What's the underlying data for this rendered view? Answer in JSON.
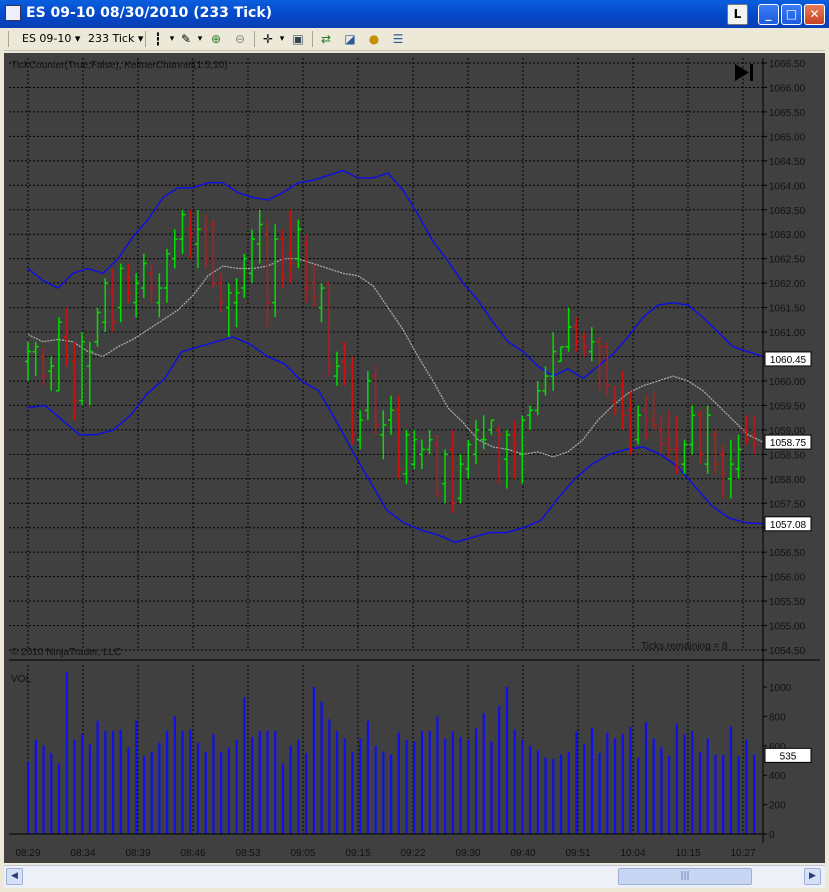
{
  "window": {
    "title": "ES 09-10  08/30/2010 (233 Tick)",
    "buttons": {
      "l": "L",
      "minimize": "_",
      "maximize": "□",
      "close": "✕"
    }
  },
  "toolbar": {
    "instrument": "ES 09-10",
    "period": "233 Tick",
    "icons": [
      "bar-type-icon",
      "draw-pencil-icon",
      "zoom-in-icon",
      "zoom-out-icon",
      "crosshair-icon",
      "properties-icon",
      "data-series-icon",
      "indicators-icon",
      "strategies-icon",
      "data-box-icon"
    ]
  },
  "chart": {
    "indicator_label": "TickCounter(True,False), KeltnerChannel(1.5,10)",
    "copyright": "© 2010 NinjaTrader, LLC",
    "ticks_remaining": "Ticks remaining = 8",
    "volume_label": "VOL",
    "colors": {
      "background": "#404040",
      "up_bar": "#00dd00",
      "down_bar": "#cc1111",
      "keltner_band": "#1010dd",
      "keltner_mid": "#b0b0b0",
      "volume": "#1010ee",
      "grid": "#000000",
      "label_box": "#ffffff"
    }
  },
  "chart_data": {
    "type": "bar",
    "subtype": "ohlc_price_with_volume",
    "price_axis": {
      "min": 1054.5,
      "max": 1066.5,
      "ticks": [
        "1066.50",
        "1066.00",
        "1065.50",
        "1065.00",
        "1064.50",
        "1064.00",
        "1063.50",
        "1063.00",
        "1062.50",
        "1062.00",
        "1061.50",
        "1061.00",
        "1060.50",
        "1060.00",
        "1059.50",
        "1059.00",
        "1058.50",
        "1058.00",
        "1057.50",
        "1057.00",
        "1056.50",
        "1056.00",
        "1055.50",
        "1055.00",
        "1054.50"
      ]
    },
    "volume_axis": {
      "min": 0,
      "max": 1000,
      "ticks": [
        "1000",
        "800",
        "600",
        "400",
        "200",
        "0"
      ]
    },
    "x_tick_labels": [
      "08:29",
      "08:34",
      "08:39",
      "08:46",
      "08:53",
      "09:05",
      "09:15",
      "09:22",
      "09:30",
      "09:40",
      "09:51",
      "10:04",
      "10:15",
      "10:27"
    ],
    "price_markers": {
      "keltner_upper": "1060.45",
      "last_price": "1058.75",
      "keltner_lower": "1057.08"
    },
    "volume_marker": "535",
    "ohlc": [
      [
        1060.4,
        1060.8,
        1060.0,
        1060.6
      ],
      [
        1060.6,
        1060.8,
        1060.1,
        1060.7
      ],
      [
        1060.5,
        1060.7,
        1059.9,
        1060.1
      ],
      [
        1060.2,
        1060.5,
        1059.8,
        1060.3
      ],
      [
        1059.8,
        1061.3,
        1059.8,
        1061.2
      ],
      [
        1060.9,
        1061.5,
        1060.3,
        1060.5
      ],
      [
        1060.4,
        1060.8,
        1059.2,
        1059.6
      ],
      [
        1059.6,
        1061.0,
        1059.5,
        1060.8
      ],
      [
        1060.3,
        1060.8,
        1059.5,
        1060.6
      ],
      [
        1060.8,
        1061.5,
        1060.7,
        1061.4
      ],
      [
        1061.2,
        1062.1,
        1061.0,
        1062.0
      ],
      [
        1061.8,
        1062.3,
        1061.0,
        1061.2
      ],
      [
        1061.5,
        1062.4,
        1061.2,
        1062.3
      ],
      [
        1062.1,
        1062.4,
        1061.6,
        1061.8
      ],
      [
        1061.6,
        1062.2,
        1061.3,
        1062.0
      ],
      [
        1061.9,
        1062.6,
        1061.7,
        1062.4
      ],
      [
        1062.2,
        1062.4,
        1061.6,
        1061.9
      ],
      [
        1061.6,
        1062.2,
        1061.3,
        1061.9
      ],
      [
        1061.9,
        1062.7,
        1061.6,
        1062.6
      ],
      [
        1062.5,
        1063.1,
        1062.3,
        1062.9
      ],
      [
        1062.9,
        1063.5,
        1062.6,
        1063.4
      ],
      [
        1063.1,
        1063.5,
        1062.5,
        1063.0
      ],
      [
        1062.8,
        1063.5,
        1062.3,
        1063.1
      ],
      [
        1063.1,
        1063.4,
        1062.3,
        1062.5
      ],
      [
        1063.2,
        1063.3,
        1061.9,
        1062.0
      ],
      [
        1062.0,
        1062.2,
        1061.4,
        1061.6
      ],
      [
        1061.5,
        1062.0,
        1060.9,
        1061.8
      ],
      [
        1061.6,
        1062.1,
        1061.1,
        1061.8
      ],
      [
        1061.9,
        1062.6,
        1061.7,
        1062.5
      ],
      [
        1062.2,
        1063.1,
        1062.0,
        1062.9
      ],
      [
        1062.8,
        1063.5,
        1062.4,
        1063.2
      ],
      [
        1063.0,
        1063.3,
        1061.1,
        1061.6
      ],
      [
        1061.6,
        1063.2,
        1061.3,
        1062.9
      ],
      [
        1062.9,
        1063.1,
        1061.9,
        1062.1
      ],
      [
        1062.6,
        1063.5,
        1062.0,
        1062.4
      ],
      [
        1062.5,
        1063.3,
        1062.3,
        1063.1
      ],
      [
        1062.8,
        1063.0,
        1061.6,
        1061.9
      ],
      [
        1062.0,
        1062.4,
        1061.5,
        1061.7
      ],
      [
        1061.5,
        1062.0,
        1061.2,
        1061.9
      ],
      [
        1062.0,
        1062.0,
        1060.1,
        1060.3
      ],
      [
        1060.1,
        1060.6,
        1059.9,
        1060.3
      ],
      [
        1060.4,
        1060.8,
        1059.9,
        1060.2
      ],
      [
        1060.3,
        1060.5,
        1058.7,
        1058.9
      ],
      [
        1058.8,
        1059.4,
        1058.6,
        1059.2
      ],
      [
        1059.4,
        1060.2,
        1059.2,
        1060.0
      ],
      [
        1060.1,
        1060.3,
        1058.9,
        1059.1
      ],
      [
        1058.9,
        1059.4,
        1058.4,
        1059.1
      ],
      [
        1059.2,
        1059.7,
        1058.9,
        1059.4
      ],
      [
        1059.4,
        1059.7,
        1058.0,
        1058.2
      ],
      [
        1058.1,
        1059.0,
        1057.9,
        1058.9
      ],
      [
        1058.3,
        1059.0,
        1058.2,
        1058.8
      ],
      [
        1058.5,
        1058.8,
        1058.2,
        1058.6
      ],
      [
        1058.6,
        1059.0,
        1058.5,
        1058.8
      ],
      [
        1058.7,
        1058.9,
        1057.6,
        1057.7
      ],
      [
        1057.9,
        1058.6,
        1057.5,
        1058.5
      ],
      [
        1058.6,
        1059.0,
        1057.3,
        1057.5
      ],
      [
        1057.6,
        1058.5,
        1057.5,
        1058.3
      ],
      [
        1058.2,
        1058.8,
        1058.0,
        1058.7
      ],
      [
        1058.5,
        1059.2,
        1058.3,
        1059.0
      ],
      [
        1058.8,
        1059.3,
        1058.6,
        1058.8
      ],
      [
        1059.0,
        1059.2,
        1058.9,
        1059.2
      ],
      [
        1059.0,
        1059.1,
        1057.9,
        1058.9
      ],
      [
        1058.4,
        1059.0,
        1057.8,
        1058.9
      ],
      [
        1058.9,
        1059.2,
        1058.0,
        1058.7
      ],
      [
        1058.5,
        1059.3,
        1057.9,
        1059.2
      ],
      [
        1059.3,
        1059.5,
        1059.0,
        1059.4
      ],
      [
        1059.4,
        1060.0,
        1059.3,
        1059.8
      ],
      [
        1059.8,
        1060.3,
        1059.7,
        1060.1
      ],
      [
        1060.1,
        1061.0,
        1059.8,
        1060.6
      ],
      [
        1060.4,
        1060.7,
        1060.4,
        1060.7
      ],
      [
        1060.7,
        1061.5,
        1060.6,
        1061.1
      ],
      [
        1061.1,
        1061.3,
        1060.6,
        1060.8
      ],
      [
        1060.9,
        1061.0,
        1060.5,
        1060.7
      ],
      [
        1060.6,
        1061.1,
        1060.4,
        1060.8
      ],
      [
        1060.8,
        1060.9,
        1059.8,
        1060.7
      ],
      [
        1060.7,
        1060.8,
        1059.7,
        1059.9
      ],
      [
        1059.6,
        1059.9,
        1059.3,
        1059.4
      ],
      [
        1059.9,
        1060.2,
        1059.0,
        1059.3
      ],
      [
        1059.4,
        1059.8,
        1058.5,
        1058.6
      ],
      [
        1058.8,
        1059.5,
        1058.7,
        1059.3
      ],
      [
        1059.4,
        1059.7,
        1058.8,
        1058.9
      ],
      [
        1059.2,
        1059.8,
        1059.0,
        1059.1
      ],
      [
        1059.0,
        1059.3,
        1058.5,
        1058.7
      ],
      [
        1058.8,
        1059.4,
        1058.4,
        1058.6
      ],
      [
        1058.6,
        1059.3,
        1058.1,
        1058.2
      ],
      [
        1058.3,
        1058.8,
        1058.1,
        1058.7
      ],
      [
        1058.7,
        1059.5,
        1058.5,
        1059.3
      ],
      [
        1059.3,
        1059.4,
        1058.3,
        1058.5
      ],
      [
        1058.3,
        1059.5,
        1058.1,
        1059.3
      ],
      [
        1058.9,
        1059.0,
        1058.1,
        1058.3
      ],
      [
        1058.5,
        1058.7,
        1057.6,
        1058.1
      ],
      [
        1058.0,
        1058.8,
        1057.6,
        1058.3
      ],
      [
        1058.2,
        1058.9,
        1058.0,
        1058.6
      ],
      [
        1059.0,
        1059.3,
        1058.7,
        1058.8
      ],
      [
        1058.9,
        1059.3,
        1058.5,
        1058.7
      ]
    ],
    "keltner_upper": [
      1062.3,
      1062.05,
      1061.9,
      1062.2,
      1062.3,
      1062.2,
      1062.5,
      1062.95,
      1063.3,
      1063.75,
      1063.95,
      1063.95,
      1064.05,
      1064.05,
      1063.85,
      1063.75,
      1063.7,
      1063.85,
      1064.05,
      1064.1,
      1064.2,
      1064.3,
      1064.15,
      1064.15,
      1064.25,
      1063.9,
      1063.4,
      1062.85,
      1062.45,
      1062.0,
      1061.65,
      1061.2,
      1060.8,
      1060.6,
      1060.3,
      1060.1,
      1060.25,
      1060.05,
      1060.3,
      1060.55,
      1060.9,
      1061.3,
      1061.55,
      1061.6,
      1061.55,
      1061.3,
      1061.0,
      1060.7,
      1060.6,
      1060.5
    ],
    "keltner_mid": [
      1060.95,
      1060.8,
      1060.85,
      1060.8,
      1060.6,
      1060.5,
      1060.7,
      1060.85,
      1061.05,
      1061.25,
      1061.45,
      1061.75,
      1062.15,
      1062.35,
      1062.3,
      1062.3,
      1062.35,
      1062.5,
      1062.5,
      1062.4,
      1062.3,
      1062.2,
      1062.15,
      1061.95,
      1061.5,
      1061.05,
      1060.5,
      1060.0,
      1059.45,
      1059.15,
      1058.8,
      1058.65,
      1058.6,
      1058.5,
      1058.55,
      1058.45,
      1058.55,
      1058.8,
      1059.2,
      1059.5,
      1059.75,
      1059.9,
      1060.0,
      1060.1,
      1060.0,
      1059.8,
      1059.5,
      1059.2,
      1058.9,
      1058.75
    ],
    "keltner_lower": [
      1059.45,
      1059.5,
      1059.2,
      1058.9,
      1058.9,
      1059.0,
      1059.3,
      1059.75,
      1060.05,
      1060.6,
      1060.7,
      1060.8,
      1060.9,
      1060.75,
      1060.5,
      1060.35,
      1060.0,
      1059.8,
      1059.2,
      1058.55,
      1057.95,
      1057.35,
      1057.1,
      1056.95,
      1056.85,
      1056.7,
      1056.8,
      1056.9,
      1056.9,
      1057.0,
      1057.15,
      1057.6,
      1058.0,
      1058.3,
      1058.5,
      1058.6,
      1058.65,
      1058.5,
      1058.25,
      1057.85,
      1057.45,
      1057.2,
      1057.1,
      1057.08
    ],
    "volume": [
      490,
      640,
      600,
      550,
      480,
      1100,
      640,
      680,
      610,
      770,
      700,
      700,
      710,
      590,
      770,
      530,
      560,
      620,
      700,
      800,
      700,
      710,
      620,
      560,
      680,
      560,
      590,
      640,
      930,
      660,
      700,
      700,
      700,
      480,
      600,
      640,
      550,
      1000,
      900,
      780,
      700,
      650,
      560,
      650,
      770,
      600,
      560,
      540,
      690,
      640,
      630,
      700,
      700,
      800,
      650,
      700,
      660,
      640,
      720,
      820,
      630,
      870,
      1000,
      710,
      640,
      600,
      570,
      520,
      510,
      540,
      560,
      700,
      610,
      720,
      550,
      690,
      650,
      680,
      730,
      520,
      760,
      650,
      590,
      530,
      750,
      680,
      700,
      560,
      650,
      540,
      540,
      730,
      530,
      640,
      540
    ]
  }
}
